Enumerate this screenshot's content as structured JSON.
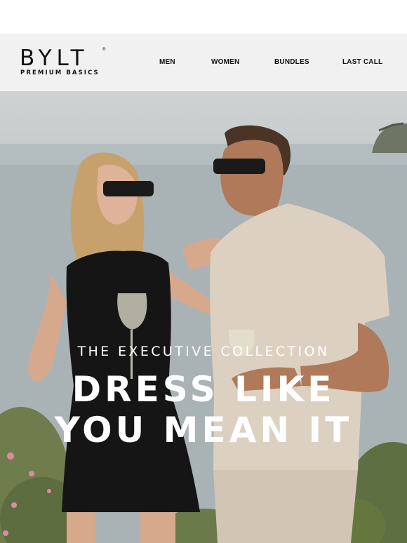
{
  "brand": {
    "name": "BYLT",
    "registered_mark": "®",
    "tagline": "PREMIUM BASICS"
  },
  "nav": {
    "items": [
      {
        "label": "MEN"
      },
      {
        "label": "WOMEN"
      },
      {
        "label": "BUNDLES"
      },
      {
        "label": "LAST CALL"
      }
    ]
  },
  "hero": {
    "eyebrow": "THE EXECUTIVE COLLECTION",
    "headline_line1": "DRESS LIKE",
    "headline_line2": "YOU MEAN IT",
    "text_color": "#ffffff"
  },
  "colors": {
    "header_bg": "#f1f1f1",
    "text_dark": "#111111"
  }
}
